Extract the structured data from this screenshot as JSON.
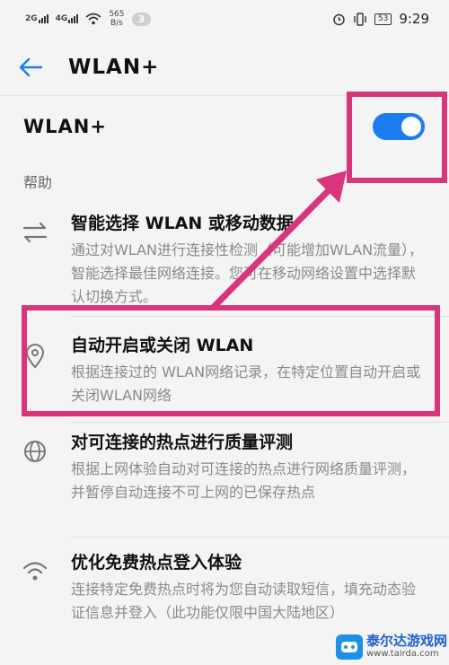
{
  "status_bar": {
    "signal1": "2G",
    "signal2": "4G",
    "speed_value": "565",
    "speed_unit": "B/s",
    "notification_count": "3",
    "battery": "53",
    "time": "9:29"
  },
  "header": {
    "title": "WLAN+"
  },
  "main_toggle": {
    "label": "WLAN+",
    "enabled": true,
    "color": "#1e7cf2"
  },
  "help": {
    "section_title": "帮助",
    "items": [
      {
        "icon": "swap-arrows-icon",
        "title": "智能选择 WLAN 或移动数据",
        "description": "通过对WLAN进行连接性检测（可能增加WLAN流量），智能选择最佳网络连接。您可在移动网络设置中选择默认切换方式。"
      },
      {
        "icon": "location-pin-icon",
        "title": "自动开启或关闭 WLAN",
        "description": "根据连接过的 WLAN网络记录，在特定位置自动开启或关闭WLAN网络"
      },
      {
        "icon": "globe-icon",
        "title": "对可连接的热点进行质量评测",
        "description": "根据上网体验自动对可连接的热点进行网络质量评测，并暂停自动连接不可上网的已保存热点"
      },
      {
        "icon": "wifi-icon",
        "title": "优化免费热点登入体验",
        "description": "连接特定免费热点时将为您自动读取短信，填充动态验证信息并登入（此功能仅限中国大陆地区）"
      }
    ]
  },
  "annotation_color": "#d9357a",
  "watermark": {
    "line1": "泰尔达游戏网",
    "line2": "www.tairda.com"
  }
}
